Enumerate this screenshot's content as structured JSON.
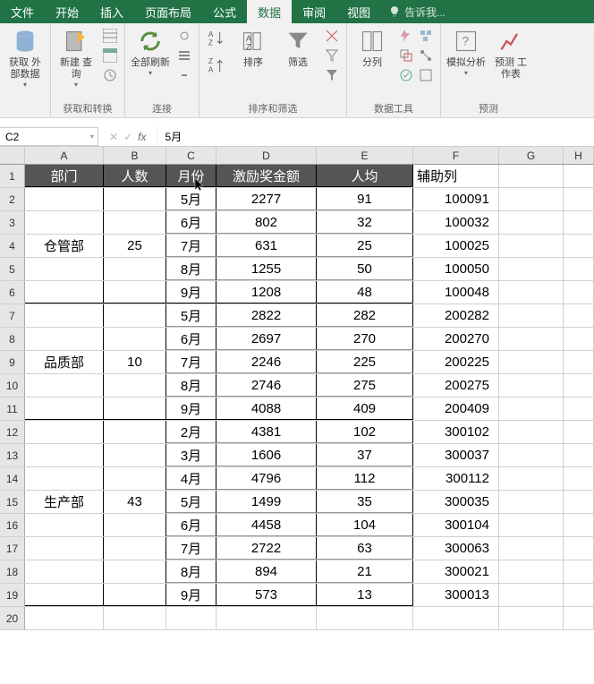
{
  "tabs": {
    "file": "文件",
    "home": "开始",
    "insert": "插入",
    "layout": "页面布局",
    "formulas": "公式",
    "data": "数据",
    "review": "审阅",
    "view": "视图",
    "tell_me": "告诉我..."
  },
  "ribbon": {
    "get_external": "获取\n外部数据",
    "new_query": "新建\n查询",
    "group_get": "获取和转换",
    "refresh_all": "全部刷新",
    "group_conn": "连接",
    "sort": "排序",
    "filter": "筛选",
    "group_sort": "排序和筛选",
    "text_cols": "分列",
    "group_tools": "数据工具",
    "what_if": "模拟分析",
    "forecast": "预测\n工作表",
    "group_forecast": "预测"
  },
  "cellref": "C2",
  "formula": "5月",
  "columns": [
    "A",
    "B",
    "C",
    "D",
    "E",
    "F",
    "G",
    "H"
  ],
  "headers": {
    "A": "部门",
    "B": "人数",
    "C": "月份",
    "D": "激励奖金额",
    "E": "人均",
    "F": "辅助列"
  },
  "rows": [
    {
      "r": 2,
      "A": "",
      "B": "",
      "C": "5月",
      "D": "2277",
      "E": "91",
      "F": "100091"
    },
    {
      "r": 3,
      "A": "",
      "B": "",
      "C": "6月",
      "D": "802",
      "E": "32",
      "F": "100032"
    },
    {
      "r": 4,
      "A": "仓管部",
      "B": "25",
      "C": "7月",
      "D": "631",
      "E": "25",
      "F": "100025"
    },
    {
      "r": 5,
      "A": "",
      "B": "",
      "C": "8月",
      "D": "1255",
      "E": "50",
      "F": "100050"
    },
    {
      "r": 6,
      "A": "",
      "B": "",
      "C": "9月",
      "D": "1208",
      "E": "48",
      "F": "100048"
    },
    {
      "r": 7,
      "A": "",
      "B": "",
      "C": "5月",
      "D": "2822",
      "E": "282",
      "F": "200282"
    },
    {
      "r": 8,
      "A": "",
      "B": "",
      "C": "6月",
      "D": "2697",
      "E": "270",
      "F": "200270"
    },
    {
      "r": 9,
      "A": "品质部",
      "B": "10",
      "C": "7月",
      "D": "2246",
      "E": "225",
      "F": "200225"
    },
    {
      "r": 10,
      "A": "",
      "B": "",
      "C": "8月",
      "D": "2746",
      "E": "275",
      "F": "200275"
    },
    {
      "r": 11,
      "A": "",
      "B": "",
      "C": "9月",
      "D": "4088",
      "E": "409",
      "F": "200409"
    },
    {
      "r": 12,
      "A": "",
      "B": "",
      "C": "2月",
      "D": "4381",
      "E": "102",
      "F": "300102"
    },
    {
      "r": 13,
      "A": "",
      "B": "",
      "C": "3月",
      "D": "1606",
      "E": "37",
      "F": "300037"
    },
    {
      "r": 14,
      "A": "",
      "B": "",
      "C": "4月",
      "D": "4796",
      "E": "112",
      "F": "300112"
    },
    {
      "r": 15,
      "A": "生产部",
      "B": "43",
      "C": "5月",
      "D": "1499",
      "E": "35",
      "F": "300035"
    },
    {
      "r": 16,
      "A": "",
      "B": "",
      "C": "6月",
      "D": "4458",
      "E": "104",
      "F": "300104"
    },
    {
      "r": 17,
      "A": "",
      "B": "",
      "C": "7月",
      "D": "2722",
      "E": "63",
      "F": "300063"
    },
    {
      "r": 18,
      "A": "",
      "B": "",
      "C": "8月",
      "D": "894",
      "E": "21",
      "F": "300021"
    },
    {
      "r": 19,
      "A": "",
      "B": "",
      "C": "9月",
      "D": "573",
      "E": "13",
      "F": "300013"
    }
  ],
  "merges": {
    "A": [
      {
        "from": 2,
        "to": 6,
        "text": "仓管部"
      },
      {
        "from": 7,
        "to": 11,
        "text": "品质部"
      },
      {
        "from": 12,
        "to": 19,
        "text": "生产部"
      }
    ],
    "B": [
      {
        "from": 2,
        "to": 6,
        "text": "25"
      },
      {
        "from": 7,
        "to": 11,
        "text": "10"
      },
      {
        "from": 12,
        "to": 19,
        "text": "43"
      }
    ]
  },
  "group_breaks": [
    6,
    11,
    19
  ],
  "thick_border_cols": [
    "A",
    "B",
    "C",
    "D",
    "E"
  ]
}
